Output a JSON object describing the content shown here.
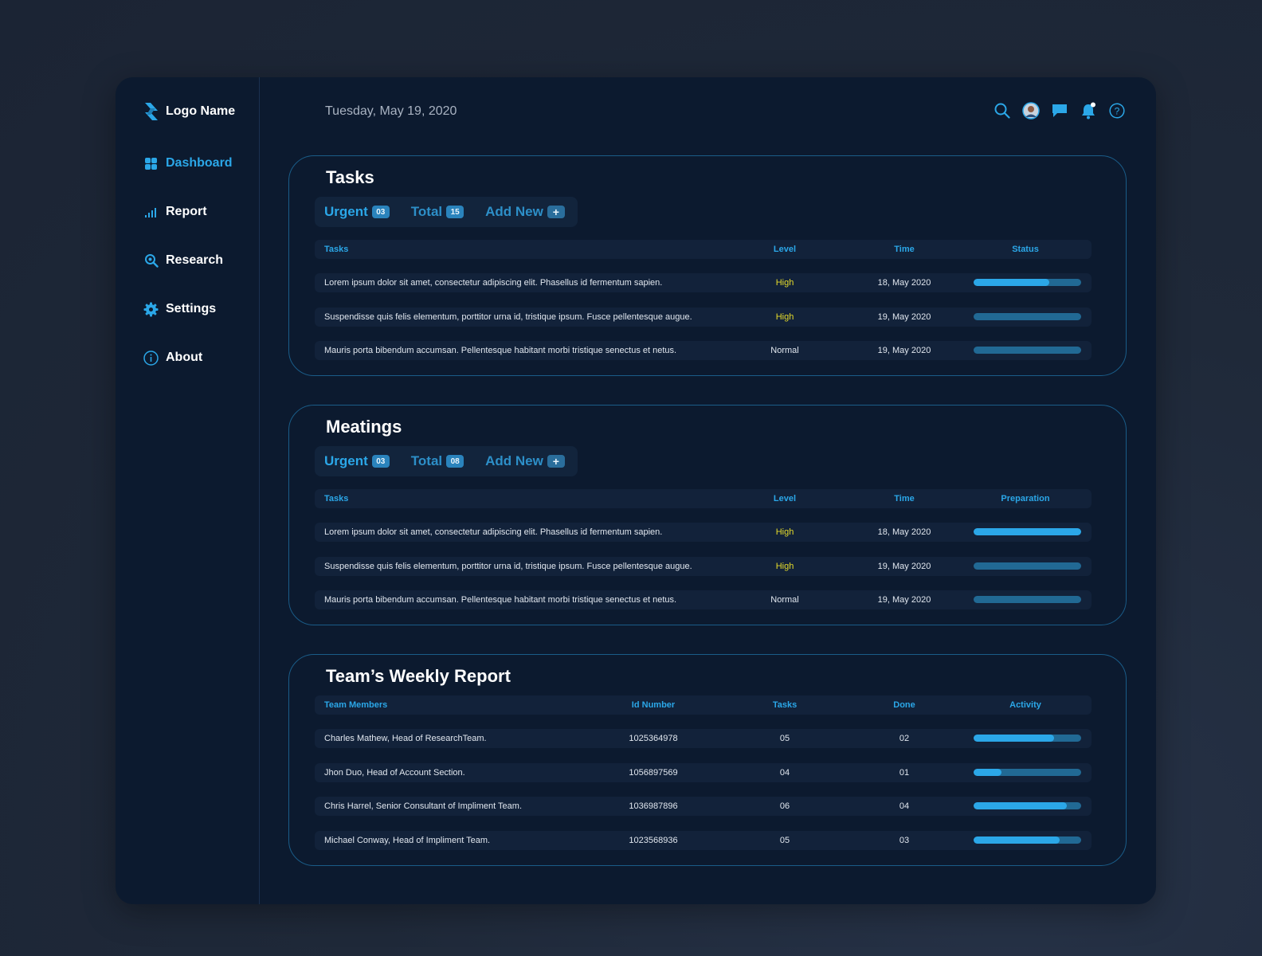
{
  "sidebar": {
    "logo": "Logo Name",
    "items": [
      {
        "label": "Dashboard",
        "icon": "dashboard-icon",
        "active": true
      },
      {
        "label": "Report",
        "icon": "bar-chart-icon"
      },
      {
        "label": "Research",
        "icon": "search-icon"
      },
      {
        "label": "Settings",
        "icon": "gear-icon"
      },
      {
        "label": "About",
        "icon": "info-icon"
      }
    ]
  },
  "header": {
    "date": "Tuesday, May 19, 2020",
    "icons": [
      "search-icon",
      "avatar",
      "chat-icon",
      "bell-icon",
      "help-icon"
    ]
  },
  "colors": {
    "accent": "#2ba7e8",
    "high": "#e6dc2b",
    "card_border": "#1a5c88",
    "background": "#0c1a2f"
  },
  "tasks": {
    "title": "Tasks",
    "tabs": {
      "urgent": "Urgent",
      "urgent_count": "03",
      "total": "Total",
      "total_count": "15",
      "add_new": "Add New",
      "add_icon": "+"
    },
    "columns": [
      "Tasks",
      "Level",
      "Time",
      "Status"
    ],
    "rows": [
      {
        "task": "Lorem ipsum dolor sit amet, consectetur adipiscing elit. Phasellus id fermentum sapien.",
        "level": "High",
        "time": "18, May 2020",
        "progress": 0.7
      },
      {
        "task": "Suspendisse quis felis elementum, porttitor urna id, tristique ipsum. Fusce pellentesque augue.",
        "level": "High",
        "time": "19, May 2020",
        "progress": 0
      },
      {
        "task": "Mauris porta bibendum accumsan. Pellentesque habitant morbi tristique senectus et netus.",
        "level": "Normal",
        "time": "19, May 2020",
        "progress": 0
      }
    ]
  },
  "meetings": {
    "title": "Meatings",
    "tabs": {
      "urgent": "Urgent",
      "urgent_count": "03",
      "total": "Total",
      "total_count": "08",
      "add_new": "Add New",
      "add_icon": "+"
    },
    "columns": [
      "Tasks",
      "Level",
      "Time",
      "Preparation"
    ],
    "rows": [
      {
        "task": "Lorem ipsum dolor sit amet, consectetur adipiscing elit. Phasellus id fermentum sapien.",
        "level": "High",
        "time": "18, May 2020",
        "progress": 1.0
      },
      {
        "task": "Suspendisse quis felis elementum, porttitor urna id, tristique ipsum. Fusce pellentesque augue.",
        "level": "High",
        "time": "19, May 2020",
        "progress": 0
      },
      {
        "task": "Mauris porta bibendum accumsan. Pellentesque habitant morbi tristique senectus et netus.",
        "level": "Normal",
        "time": "19, May 2020",
        "progress": 0
      }
    ]
  },
  "report": {
    "title": "Team’s Weekly Report",
    "columns": [
      "Team Members",
      "Id Number",
      "Tasks",
      "Done",
      "Activity"
    ],
    "rows": [
      {
        "member": "Charles Mathew, Head of ResearchTeam.",
        "id": "1025364978",
        "tasks": "05",
        "done": "02",
        "activity": 0.75
      },
      {
        "member": "Jhon Duo, Head of Account Section.",
        "id": "1056897569",
        "tasks": "04",
        "done": "01",
        "activity": 0.26
      },
      {
        "member": "Chris Harrel, Senior Consultant of Impliment Team.",
        "id": "1036987896",
        "tasks": "06",
        "done": "04",
        "activity": 0.87
      },
      {
        "member": "Michael Conway,  Head of Impliment Team.",
        "id": "1023568936",
        "tasks": "05",
        "done": "03",
        "activity": 0.8
      }
    ]
  }
}
